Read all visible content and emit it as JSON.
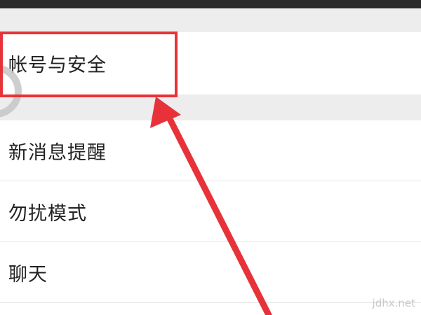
{
  "settings": {
    "items": [
      {
        "label": "帐号与安全"
      },
      {
        "label": "新消息提醒"
      },
      {
        "label": "勿扰模式"
      },
      {
        "label": "聊天"
      }
    ]
  },
  "annotation": {
    "highlight_color": "#e8323a",
    "arrow_color": "#e8323a"
  },
  "watermark": "jdhx.net"
}
